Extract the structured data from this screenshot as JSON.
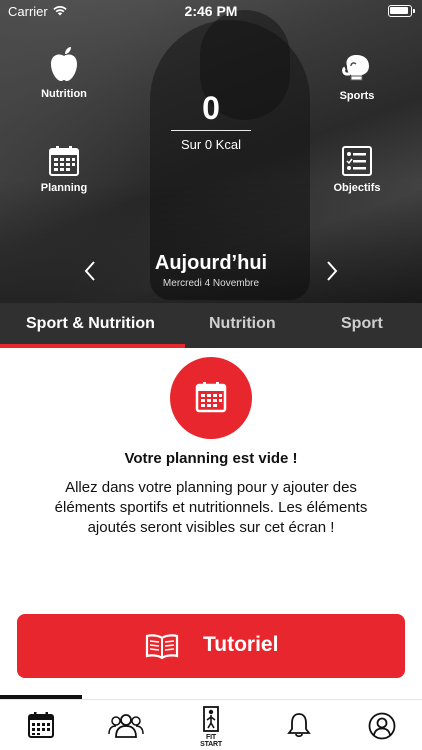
{
  "status_bar": {
    "carrier": "Carrier",
    "time": "2:46 PM"
  },
  "hero": {
    "buttons": {
      "nutrition": "Nutrition",
      "sports": "Sports",
      "planning": "Planning",
      "objectifs": "Objectifs"
    },
    "calories": {
      "value": "0",
      "subtitle": "Sur 0 Kcal"
    },
    "day": {
      "title": "Aujourd’hui",
      "date": "Mercredi 4 Novembre",
      "prev_icon": "chevron-left-icon",
      "next_icon": "chevron-right-icon"
    }
  },
  "tabs": [
    {
      "label": "Sport & Nutrition",
      "active": true
    },
    {
      "label": "Nutrition",
      "active": false
    },
    {
      "label": "Sport",
      "active": false
    }
  ],
  "empty_state": {
    "icon": "calendar-icon",
    "title": "Votre planning est vide !",
    "text": "Allez dans votre planning pour y ajouter des éléments sportifs et nutritionnels. Les éléments ajoutés seront visibles sur cet écran !"
  },
  "tutorial_button": {
    "label": "Tutoriel",
    "icon": "book-icon"
  },
  "bottom_nav": {
    "items": [
      "calendar-icon",
      "users-icon",
      "fit-start-icon",
      "bell-icon",
      "profile-icon"
    ],
    "fit_label": "FIT START"
  },
  "colors": {
    "accent": "#e8262d",
    "tab_bar": "#303030"
  }
}
